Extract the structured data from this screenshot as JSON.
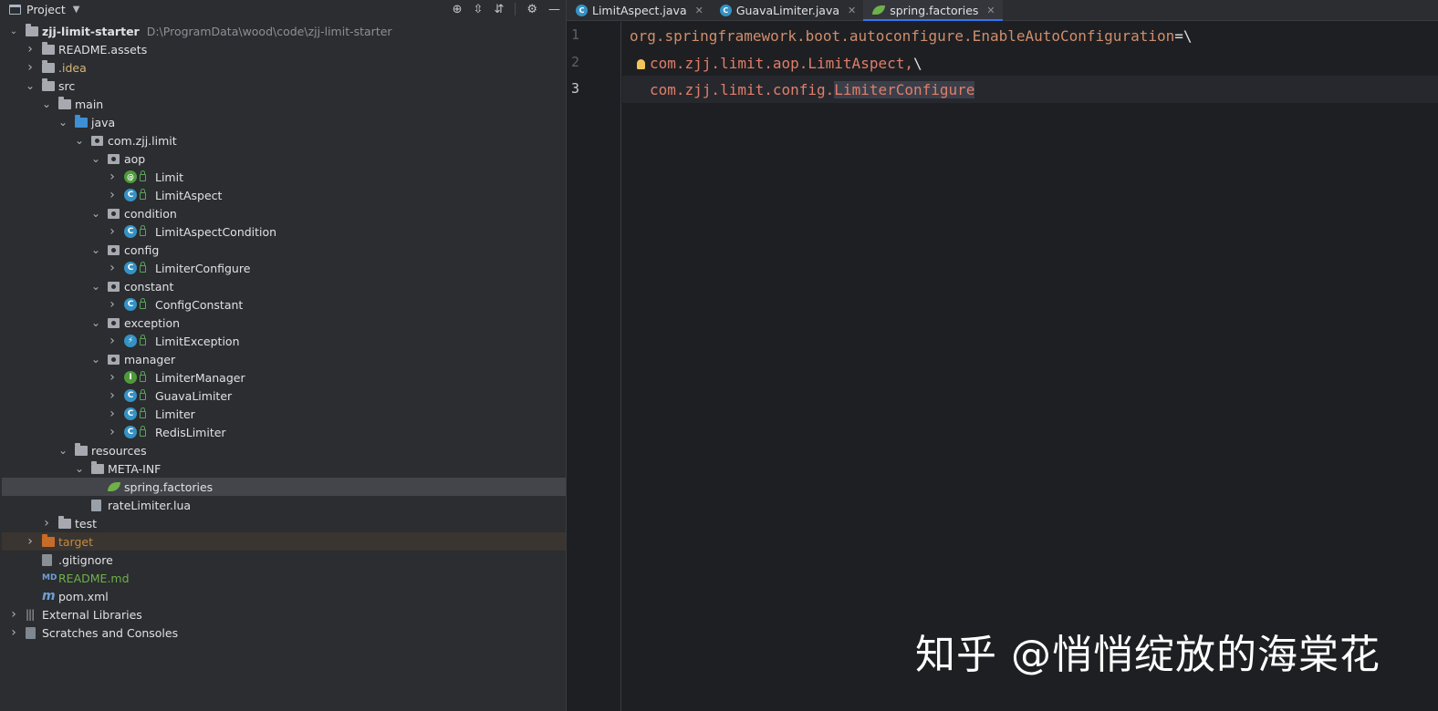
{
  "project_panel": {
    "title": "Project",
    "root": {
      "name": "zjj-limit-starter",
      "path": "D:\\ProgramData\\wood\\code\\zjj-limit-starter"
    },
    "tree": [
      {
        "label": "README.assets",
        "depth": 1,
        "arrow": ">",
        "icon": "folder-icon"
      },
      {
        "label": ".idea",
        "depth": 1,
        "arrow": ">",
        "icon": "folder-icon",
        "color": "#d5b778"
      },
      {
        "label": "src",
        "depth": 1,
        "arrow": "v",
        "icon": "folder-icon"
      },
      {
        "label": "main",
        "depth": 2,
        "arrow": "v",
        "icon": "folder-icon"
      },
      {
        "label": "java",
        "depth": 3,
        "arrow": "v",
        "icon": "source-folder-icon"
      },
      {
        "label": "com.zjj.limit",
        "depth": 4,
        "arrow": "v",
        "icon": "package-icon"
      },
      {
        "label": "aop",
        "depth": 5,
        "arrow": "v",
        "icon": "package-icon"
      },
      {
        "label": "Limit",
        "depth": 6,
        "arrow": ">",
        "icon": "annotation-icon",
        "lock": true
      },
      {
        "label": "LimitAspect",
        "depth": 6,
        "arrow": ">",
        "icon": "class-icon",
        "lock": true
      },
      {
        "label": "condition",
        "depth": 5,
        "arrow": "v",
        "icon": "package-icon"
      },
      {
        "label": "LimitAspectCondition",
        "depth": 6,
        "arrow": ">",
        "icon": "class-icon",
        "lock": true
      },
      {
        "label": "config",
        "depth": 5,
        "arrow": "v",
        "icon": "package-icon"
      },
      {
        "label": "LimiterConfigure",
        "depth": 6,
        "arrow": ">",
        "icon": "class-icon",
        "lock": true
      },
      {
        "label": "constant",
        "depth": 5,
        "arrow": "v",
        "icon": "package-icon"
      },
      {
        "label": "ConfigConstant",
        "depth": 6,
        "arrow": ">",
        "icon": "class-icon",
        "lock": true
      },
      {
        "label": "exception",
        "depth": 5,
        "arrow": "v",
        "icon": "package-icon"
      },
      {
        "label": "LimitException",
        "depth": 6,
        "arrow": ">",
        "icon": "exception-class-icon",
        "lock": true
      },
      {
        "label": "manager",
        "depth": 5,
        "arrow": "v",
        "icon": "package-icon"
      },
      {
        "label": "LimiterManager",
        "depth": 6,
        "arrow": ">",
        "icon": "interface-icon",
        "lock": true
      },
      {
        "label": "GuavaLimiter",
        "depth": 6,
        "arrow": ">",
        "icon": "class-icon",
        "lock": true
      },
      {
        "label": "Limiter",
        "depth": 6,
        "arrow": ">",
        "icon": "class-icon",
        "lock": true
      },
      {
        "label": "RedisLimiter",
        "depth": 6,
        "arrow": ">",
        "icon": "class-icon",
        "lock": true
      },
      {
        "label": "resources",
        "depth": 3,
        "arrow": "v",
        "icon": "resources-folder-icon"
      },
      {
        "label": "META-INF",
        "depth": 4,
        "arrow": "v",
        "icon": "folder-icon"
      },
      {
        "label": "spring.factories",
        "depth": 5,
        "arrow": "",
        "icon": "spring-icon",
        "selected": true
      },
      {
        "label": "rateLimiter.lua",
        "depth": 4,
        "arrow": "",
        "icon": "file-icon"
      },
      {
        "label": "test",
        "depth": 2,
        "arrow": ">",
        "icon": "folder-icon"
      },
      {
        "label": "target",
        "depth": 1,
        "arrow": ">",
        "icon": "excluded-folder-icon",
        "color": "#c78a3b",
        "excluded": true
      },
      {
        "label": ".gitignore",
        "depth": 1,
        "arrow": "",
        "icon": "gitignore-icon"
      },
      {
        "label": "README.md",
        "depth": 1,
        "arrow": "",
        "icon": "markdown-icon",
        "color": "#6fb04a"
      },
      {
        "label": "pom.xml",
        "depth": 1,
        "arrow": "",
        "icon": "maven-icon"
      },
      {
        "label": "External Libraries",
        "depth": 0,
        "arrow": ">",
        "icon": "libraries-icon"
      },
      {
        "label": "Scratches and Consoles",
        "depth": 0,
        "arrow": ">",
        "icon": "scratches-icon"
      }
    ]
  },
  "tabs": [
    {
      "label": "LimitAspect.java",
      "icon": "class-icon",
      "active": false
    },
    {
      "label": "GuavaLimiter.java",
      "icon": "class-icon",
      "active": false
    },
    {
      "label": "spring.factories",
      "icon": "spring-icon",
      "active": true
    }
  ],
  "editor": {
    "line_numbers": [
      "1",
      "2",
      "3"
    ],
    "current_line": 3,
    "lines": [
      {
        "key": "org.springframework.boot.autoconfigure.EnableAutoConfiguration",
        "sep": "=\\"
      },
      {
        "indent": "",
        "value": "com.zjj.limit.aop.LimitAspect,",
        "tail": "\\"
      },
      {
        "indent": "",
        "value_prefix": "com.zjj.limit.config.",
        "value_highlight": "LimiterConfigure"
      }
    ]
  },
  "watermark": "知乎 @悄悄绽放的海棠花"
}
